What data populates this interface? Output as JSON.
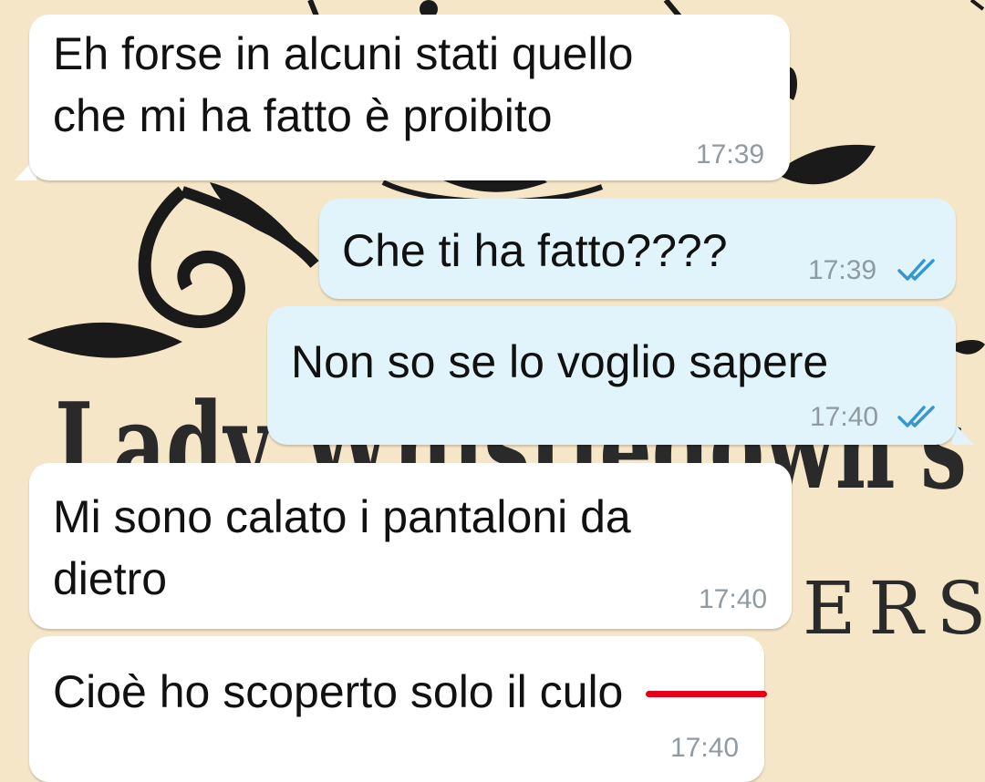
{
  "colors": {
    "wallpaper": "#f6e6c8",
    "incoming_bubble": "#ffffff",
    "outgoing_bubble": "#e1f3fb",
    "timestamp": "#8f9aa1",
    "read_ticks": "#3497d0",
    "censor_strike": "#e4001a"
  },
  "wallpaper": {
    "title_line": "Lady Whistledown's",
    "subtitle_fragment": "ERS"
  },
  "messages": [
    {
      "direction": "incoming",
      "text": "Eh forse in alcuni stati quello\nche mi ha fatto è proibito",
      "time": "17:39"
    },
    {
      "direction": "outgoing",
      "text": "Che ti ha fatto????",
      "time": "17:39",
      "status_icon": "double-check-read-icon"
    },
    {
      "direction": "outgoing",
      "text": "Non so se lo voglio sapere",
      "time": "17:40",
      "status_icon": "double-check-read-icon"
    },
    {
      "direction": "incoming",
      "text": "Mi sono calato i pantaloni da\ndietro",
      "time": "17:40"
    },
    {
      "direction": "incoming",
      "text": "Cioè ho scoperto solo il",
      "censored_word": "culo",
      "time": "17:40"
    }
  ]
}
